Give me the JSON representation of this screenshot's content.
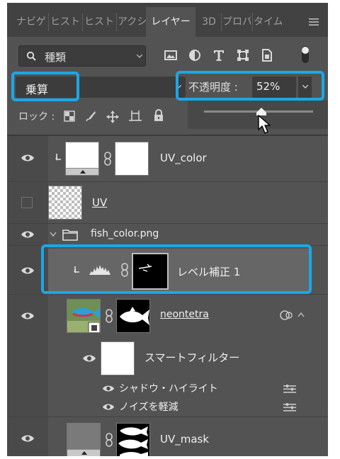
{
  "tabs": [
    {
      "label": "ナビゲ",
      "active": false
    },
    {
      "label": "ヒスト",
      "active": false
    },
    {
      "label": "ヒスト",
      "active": false
    },
    {
      "label": "アクシ",
      "active": false
    },
    {
      "label": "レイヤー",
      "active": true
    },
    {
      "label": "3D",
      "active": false
    },
    {
      "label": "プロパ",
      "active": false
    },
    {
      "label": "タイム",
      "active": false
    }
  ],
  "filter": {
    "label": "種類"
  },
  "blend": {
    "mode": "乗算"
  },
  "opacity": {
    "label": "不透明度 :",
    "value": "52%",
    "level": 0.52
  },
  "lock": {
    "label": "ロック :"
  },
  "layers": [
    {
      "name": "UV_color",
      "visible": true
    },
    {
      "name": "UV",
      "visible": false
    },
    {
      "name": "fish_color.png",
      "visible": true,
      "type": "group"
    },
    {
      "name": "レベル補正 1",
      "visible": true,
      "selected": true
    },
    {
      "name": "neontetra",
      "visible": true
    },
    {
      "name": "スマートフィルター",
      "visible": true
    },
    {
      "name": "シャドウ・ハイライト",
      "visible": true
    },
    {
      "name": "ノイズを軽減",
      "visible": true
    },
    {
      "name": "UV_mask",
      "visible": true
    }
  ],
  "colors": {
    "highlight": "#1aa7e8",
    "panel": "#535353",
    "selected_row": "#666666"
  }
}
